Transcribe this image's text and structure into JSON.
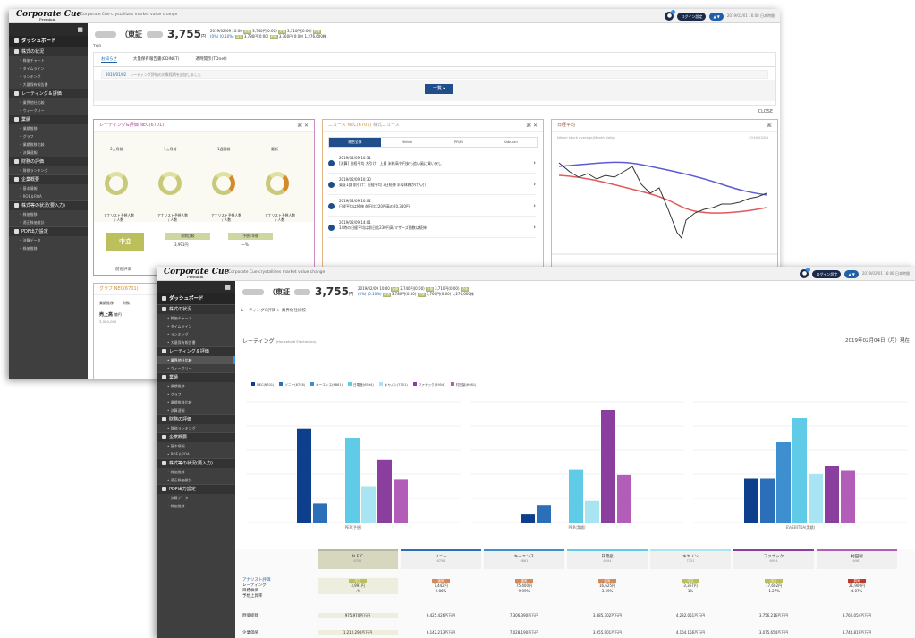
{
  "app": {
    "logo": "Corporate Cue",
    "logo_sub": "Premium",
    "tagline": "Corporate Cue crystallizes market value change",
    "user_pill": "ログイン設定",
    "user_pill2": "▲ ▼",
    "user_text": "2019/02/01 16:08 日本時間",
    "notification_count": "1"
  },
  "sidebar": {
    "dashboard": "ダッシュボード",
    "groups": [
      {
        "label": "株式の状況",
        "items": [
          "株価チャート",
          "タイムライン",
          "ランキング",
          "大量保有報告書"
        ]
      },
      {
        "label": "レーティング＆評価",
        "items": [
          "業界他社比較",
          "ウィークリー"
        ]
      },
      {
        "label": "業績",
        "items": [
          "業績推移",
          "グラフ",
          "業績推移比較",
          "決算速報"
        ]
      },
      {
        "label": "財務の評価",
        "items": [
          "財務ランキング"
        ]
      },
      {
        "label": "企業概要",
        "items": [
          "基本情報",
          "ROE＆ROA"
        ]
      },
      {
        "label": "株式等の状況(要入力)",
        "items": [
          "株価推移",
          "適正株価推計"
        ]
      },
      {
        "label": "PDF出力設定",
        "items": [
          "決算データ",
          "株価推移"
        ]
      }
    ]
  },
  "stock": {
    "exchange": "（東証",
    "price": "3,755",
    "unit": "円",
    "datetime": "2019/02/09 10:00",
    "change": "(0%) (0.10%)",
    "stats": [
      "始値",
      "高値",
      "安値",
      "終値"
    ],
    "stat_values": [
      "3,740円(0:00)",
      "3,780円(0:00)",
      "3,710円(0:00)",
      "3,760円(0:00)",
      "1,276,600株"
    ]
  },
  "window1": {
    "breadcrumb": "TOP",
    "tabs": [
      "お知らせ",
      "大量保有報告書(EDINET)",
      "適時開示(TDnet)"
    ],
    "notice_date": "2019/01/02",
    "notice_text": "レーティング評価の対象銘柄を追加しました",
    "list_button": "一覧 ▸",
    "close_button": "CLOSE",
    "rating_panel": {
      "title": "レーティング&評価 NEC(6701)",
      "columns": [
        "3ヵ月前",
        "1ヵ月前",
        "1週間前",
        "最新"
      ],
      "caption": "アナリスト予想人数 / 人数",
      "verdict": "中立",
      "boxes": [
        "前期比較",
        "予想1年後",
        "予想上昇率"
      ],
      "box_values": [
        "3,991円",
        "ー%"
      ],
      "footer": "前週評価"
    },
    "news_panel": {
      "title": "ニュース NEC(6701)",
      "checkbox": "株式ニュース",
      "tabs": [
        "総合全体",
        "Nikkei",
        "PR/IR",
        "Kabutan"
      ],
      "items": [
        {
          "date": "2019/02/09 10:31",
          "text": "[決算] 日経平均 大引け：上昇 米株高や円安も追い風に買い戻し"
        },
        {
          "date": "2019/02/09 10:30",
          "text": "東証1部 前引け：日経平均 3日続伸 半導体株がけん引"
        },
        {
          "date": "2019/02/09 10:02",
          "text": "日経平均は続伸 前日比220円高の20,380円"
        },
        {
          "date": "2019/02/09 14:01",
          "text": "14時の日経平均は前日比230円高 マザーズ指数は続伸"
        }
      ]
    },
    "chart_panel": {
      "title": "日経平均",
      "label": "Nikkei stock average(Month daily)",
      "date": "2019/02/08",
      "legend": [
        "MA25",
        "MA75"
      ]
    },
    "graph_panel": {
      "title": "グラフ NEC(6701)",
      "tabs": [
        "業績推移",
        "財務"
      ],
      "caption": "売上高",
      "unit": "億円",
      "y0": "3,000,000"
    }
  },
  "window2": {
    "breadcrumb": "レーティング&評価 > 業界他社比較",
    "section": "レーティング",
    "section_sub": "(Household Electronics)",
    "date": "2019年02月04日（月）現在",
    "legend": [
      "NEC(6701)",
      "ソニー(6758)",
      "キーエンス(6861)",
      "日電産(6594)",
      "キヤノン(7751)",
      "ファナック(6954)",
      "村田製(6981)"
    ],
    "x_labels": [
      "PER(予想)",
      "PBR(実績)",
      "EV/EBITDA(実績)"
    ],
    "y_ticks_left": [
      "50",
      "40",
      "30",
      "20",
      "10",
      "0"
    ],
    "table": {
      "row_labels": [
        "アナリスト評価",
        "レーティング",
        "目標株価",
        "予想上昇率",
        "時価総額",
        "企業価値"
      ],
      "columns": [
        {
          "name": "ＮＥＣ",
          "code": "6701",
          "rating": "中立",
          "target": "3,991円",
          "upside": "-.%",
          "mcap": "975,970百万円",
          "ev": "1,212,290百万円"
        },
        {
          "name": "ソニー",
          "code": "6758",
          "rating": "強気",
          "target": "7,442円",
          "upside": "2.86%",
          "mcap": "6,425,426百万円",
          "ev": "6,142,213百万円"
        },
        {
          "name": "キーエンス",
          "code": "6861",
          "rating": "強気",
          "target": "75,400円",
          "upside": "9.99%",
          "mcap": "7,306,390百万円",
          "ev": "7,028,190百万円"
        },
        {
          "name": "日電産",
          "code": "6594",
          "rating": "強気",
          "target": "16,625円",
          "upside": "3.69%",
          "mcap": "3,885,302百万円",
          "ev": "3,955,901百万円"
        },
        {
          "name": "キヤノン",
          "code": "7751",
          "rating": "中立",
          "target": "3,367円",
          "upside": "1%",
          "mcap": "4,232,051百万円",
          "ev": "4,164,156百万円"
        },
        {
          "name": "ファナック",
          "code": "6954",
          "rating": "中立",
          "target": "17,602円",
          "upside": "-1.27%",
          "mcap": "3,756,216百万円",
          "ev": "3,075,654百万円"
        },
        {
          "name": "村田製",
          "code": "6981",
          "rating": "弱気",
          "target": "21,900円",
          "upside": "4.07%",
          "mcap": "3,760,054百万円",
          "ev": "3,744,819百万円"
        }
      ]
    },
    "chart_data": {
      "type": "bar",
      "categories": [
        "PER(予想)",
        "PBR(実績)",
        "EV/EBITDA(実績)"
      ],
      "series": [
        {
          "name": "NEC(6701)",
          "color": "#0e3f8c",
          "values": [
            39,
            1.1,
            11
          ]
        },
        {
          "name": "ソニー(6758)",
          "color": "#2a6fb8",
          "values": [
            8,
            2.2,
            11
          ]
        },
        {
          "name": "キーエンス(6861)",
          "color": "#3d8fd0",
          "values": [
            0,
            0,
            20
          ]
        },
        {
          "name": "日電産(6594)",
          "color": "#5fcbe6",
          "values": [
            35,
            6.6,
            26
          ]
        },
        {
          "name": "キヤノン(7751)",
          "color": "#a9e4f2",
          "values": [
            15,
            2.7,
            12
          ]
        },
        {
          "name": "ファナック(6954)",
          "color": "#8a3f9e",
          "values": [
            26,
            14,
            14
          ]
        },
        {
          "name": "村田製(6981)",
          "color": "#b25db7",
          "values": [
            18,
            5.9,
            13
          ]
        }
      ],
      "ylim": [
        0,
        50
      ]
    }
  }
}
